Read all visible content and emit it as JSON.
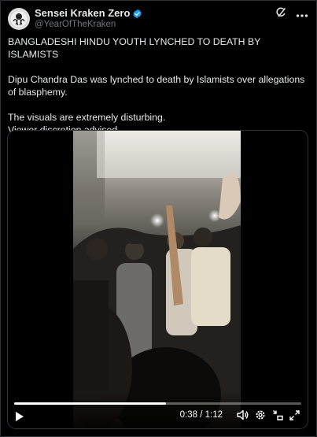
{
  "tweet": {
    "author": {
      "display_name": "Sensei Kraken Zero",
      "handle": "@YearOfTheKraken",
      "verified_badge": "verified-badge-icon",
      "accent_color": "#1d9bf0"
    },
    "header_icons": [
      "grok-icon",
      "more-icon"
    ],
    "text": {
      "p1": "BANGLADESHI HINDU YOUTH LYNCHED TO DEATH BY ISLAMISTS",
      "p2": "Dipu Chandra Das was lynched to death by Islamists over allegations of blasphemy.",
      "p3": "The visuals are extremely disturbing.\nViewer discretion advised."
    }
  },
  "video": {
    "elapsed": "0:38",
    "separator": " / ",
    "duration": "1:12",
    "progress": 0.53,
    "controls": [
      "play-icon",
      "volume-icon",
      "settings-icon",
      "minimize-icon",
      "fullscreen-icon"
    ]
  }
}
